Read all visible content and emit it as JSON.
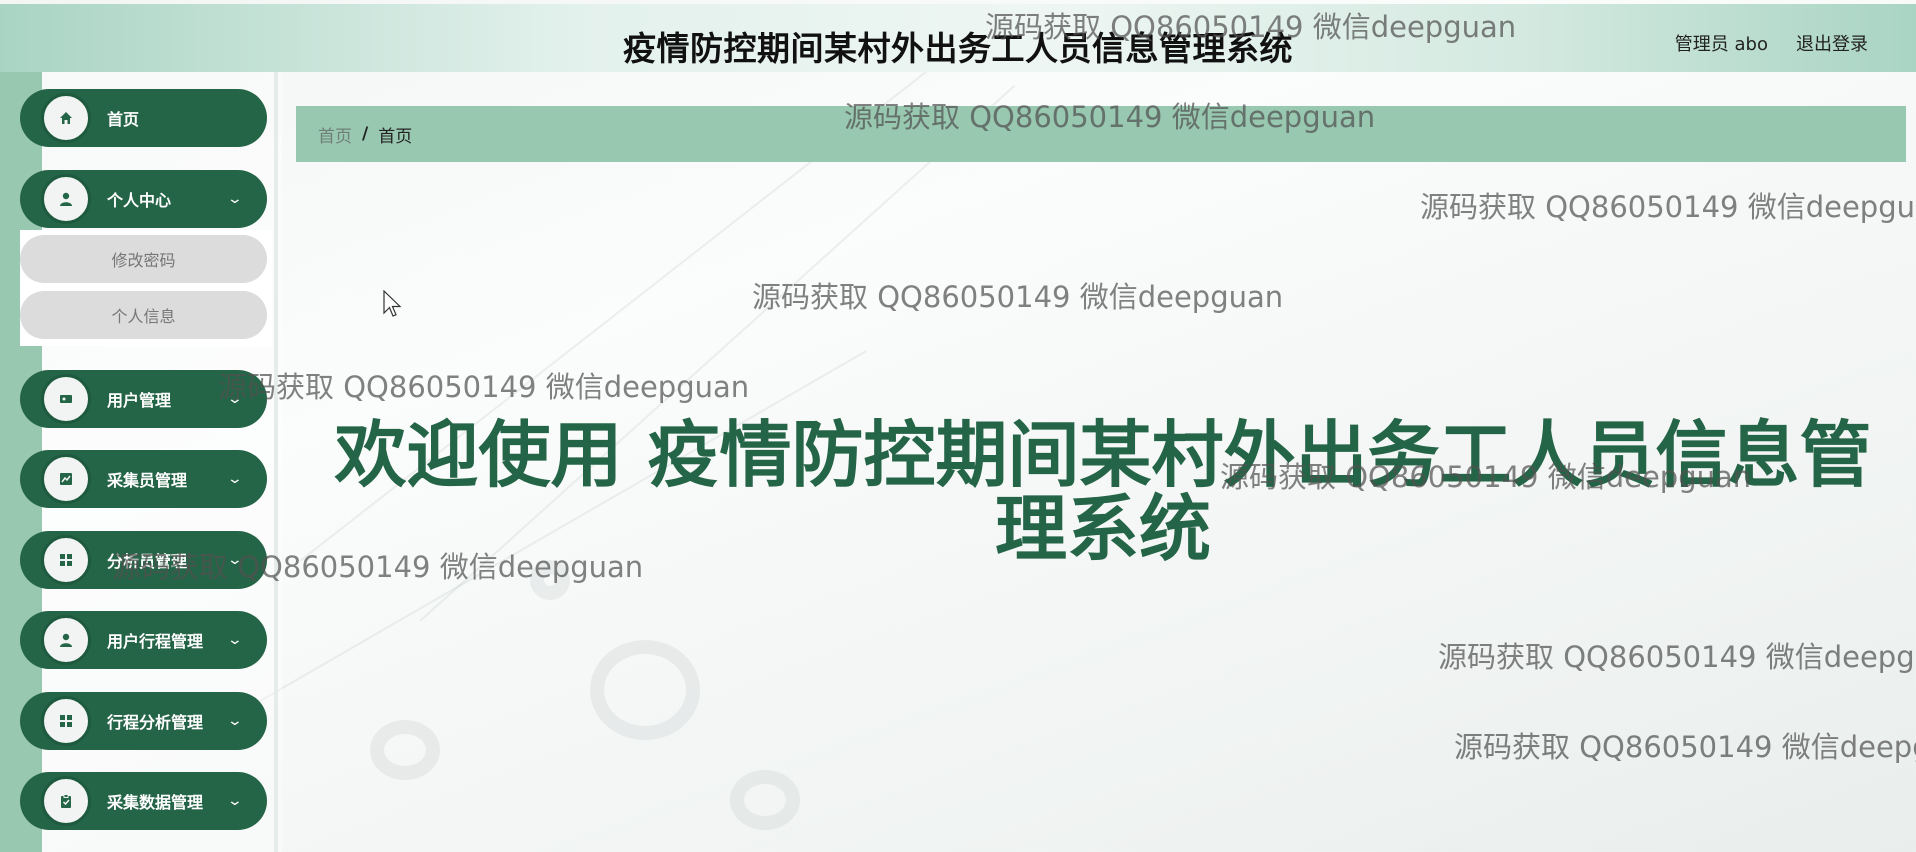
{
  "header": {
    "title": "疫情防控期间某村外出务工人员信息管理系统",
    "user": "管理员 abo",
    "logout": "退出登录"
  },
  "sidebar": {
    "items": [
      {
        "label": "首页",
        "icon": "home-icon",
        "has_children": false
      },
      {
        "label": "个人中心",
        "icon": "user-icon",
        "has_children": true
      },
      {
        "label": "用户管理",
        "icon": "id-card-icon",
        "has_children": true
      },
      {
        "label": "采集员管理",
        "icon": "chart-icon",
        "has_children": true
      },
      {
        "label": "分析员管理",
        "icon": "grid-icon",
        "has_children": true
      },
      {
        "label": "用户行程管理",
        "icon": "user-icon",
        "has_children": true
      },
      {
        "label": "行程分析管理",
        "icon": "grid-icon",
        "has_children": true
      },
      {
        "label": "采集数据管理",
        "icon": "clipboard-icon",
        "has_children": true
      }
    ],
    "submenu": [
      "修改密码",
      "个人信息"
    ]
  },
  "breadcrumb": {
    "home": "首页",
    "separator": "/",
    "current": "首页"
  },
  "main": {
    "welcome": "欢迎使用 疫情防控期间某村外出务工人员信息管理系统"
  },
  "watermark": {
    "text": "源码获取 QQ86050149 微信deepguan"
  },
  "colors": {
    "primary": "#256547",
    "accent": "#99c8b1"
  }
}
